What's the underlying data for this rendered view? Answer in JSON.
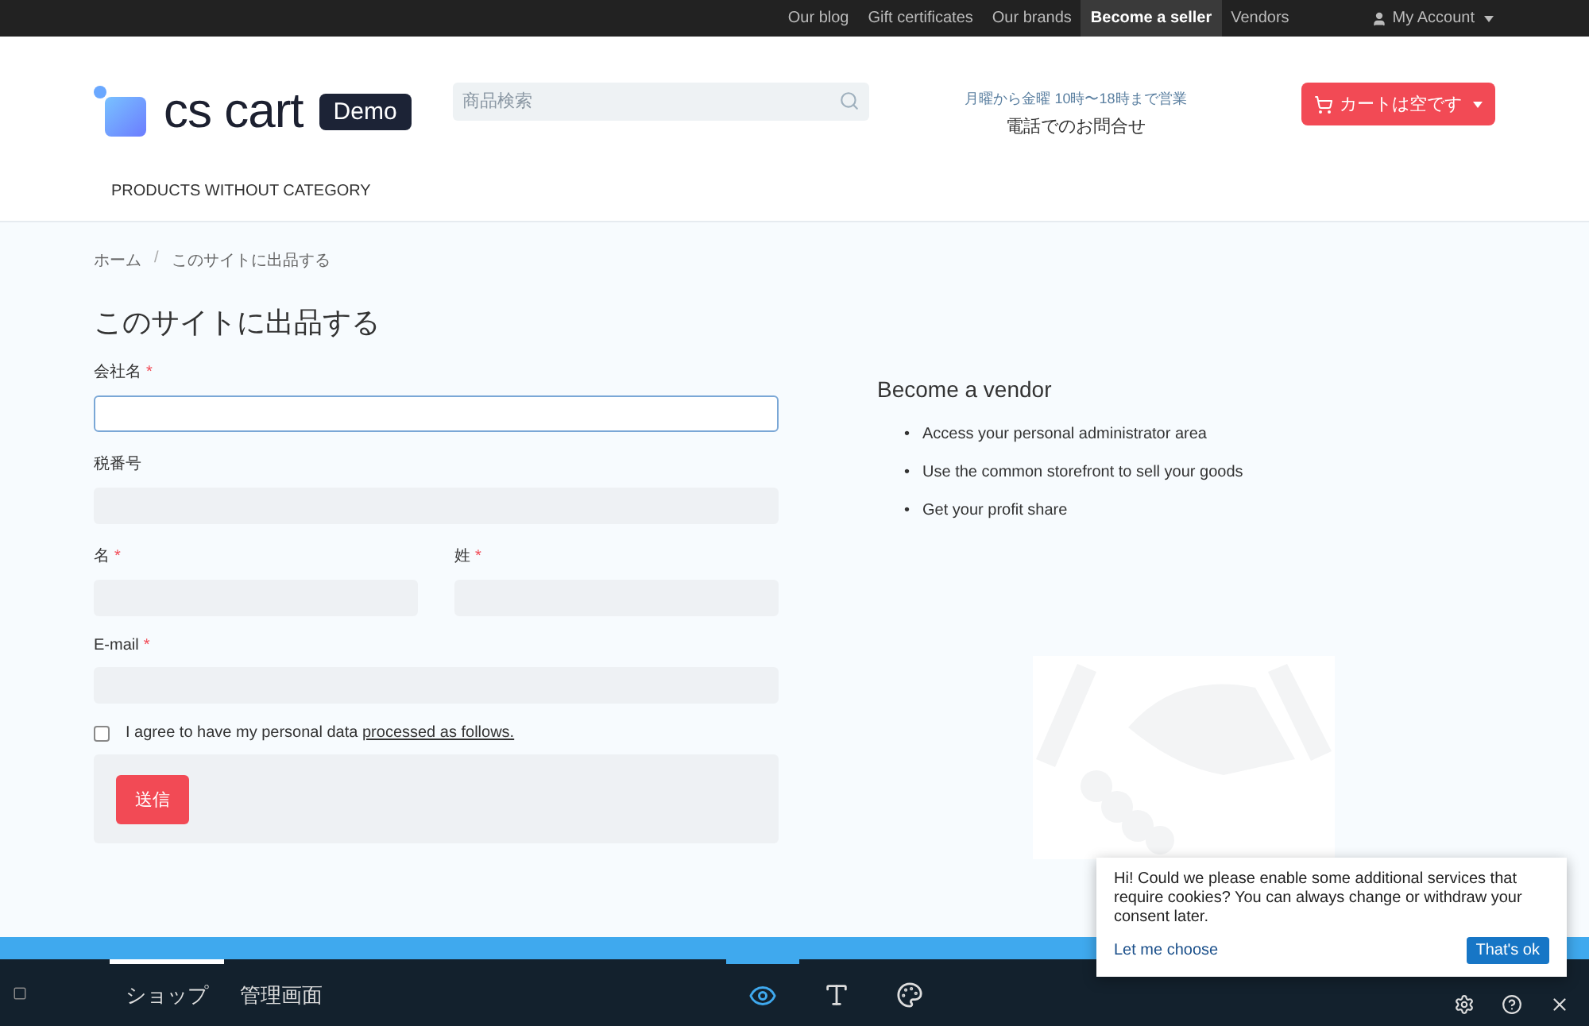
{
  "top_bar": {
    "links": [
      {
        "label": "Our blog",
        "selected": false
      },
      {
        "label": "Gift certificates",
        "selected": false
      },
      {
        "label": "Our brands",
        "selected": false
      },
      {
        "label": "Become a seller",
        "selected": true
      },
      {
        "label": "Vendors",
        "selected": false
      }
    ],
    "account": {
      "label": "My Account"
    }
  },
  "header": {
    "logo": {
      "text": "cs cart",
      "badge": "Demo"
    },
    "search": {
      "placeholder": "商品検索"
    },
    "contact": {
      "hours": "月曜から金曜 10時〜18時まで営業",
      "phone": "電話でのお問合せ"
    },
    "cart": {
      "label": "カートは空です"
    }
  },
  "nav": {
    "items": [
      {
        "label": "PRODUCTS WITHOUT CATEGORY"
      }
    ]
  },
  "breadcrumbs": [
    {
      "label": "ホーム"
    },
    {
      "label": "このサイトに出品する"
    }
  ],
  "breadcrumb_separator": "/",
  "form": {
    "title": "このサイトに出品する",
    "required_mark": "*",
    "rows": [
      [
        {
          "label": "会社名",
          "required": true,
          "focused": true
        }
      ],
      [
        {
          "label": "税番号",
          "required": false,
          "focused": false
        }
      ],
      [
        {
          "label": "名",
          "required": true,
          "focused": false
        },
        {
          "label": "姓",
          "required": true,
          "focused": false
        }
      ],
      [
        {
          "label": "E-mail",
          "required": true,
          "focused": false
        }
      ]
    ],
    "consent": {
      "text": "I agree to have my personal data",
      "link": "processed as follows.",
      "checked": false
    },
    "submit": "送信"
  },
  "vendor_info": {
    "title": "Become a vendor",
    "bullet_mark": "•",
    "bullets": [
      "Access your personal administrator area",
      "Use the common storefront to sell your goods",
      "Get your profit share"
    ]
  },
  "cookie_notice": {
    "text": "Hi! Could we please enable some additional services that require cookies? You can always change or withdraw your consent later.",
    "choose": "Let me choose",
    "accept": "That's ok"
  },
  "toolbar": {
    "tabs": [
      {
        "label": "ショップ",
        "selected": true
      },
      {
        "label": "管理画面",
        "selected": false
      }
    ],
    "tools": [
      {
        "kind": "eye",
        "selected": true
      },
      {
        "kind": "text",
        "selected": false
      },
      {
        "kind": "palette",
        "selected": false
      }
    ],
    "actions": [
      {
        "kind": "settings"
      },
      {
        "kind": "help"
      },
      {
        "kind": "close"
      }
    ]
  }
}
